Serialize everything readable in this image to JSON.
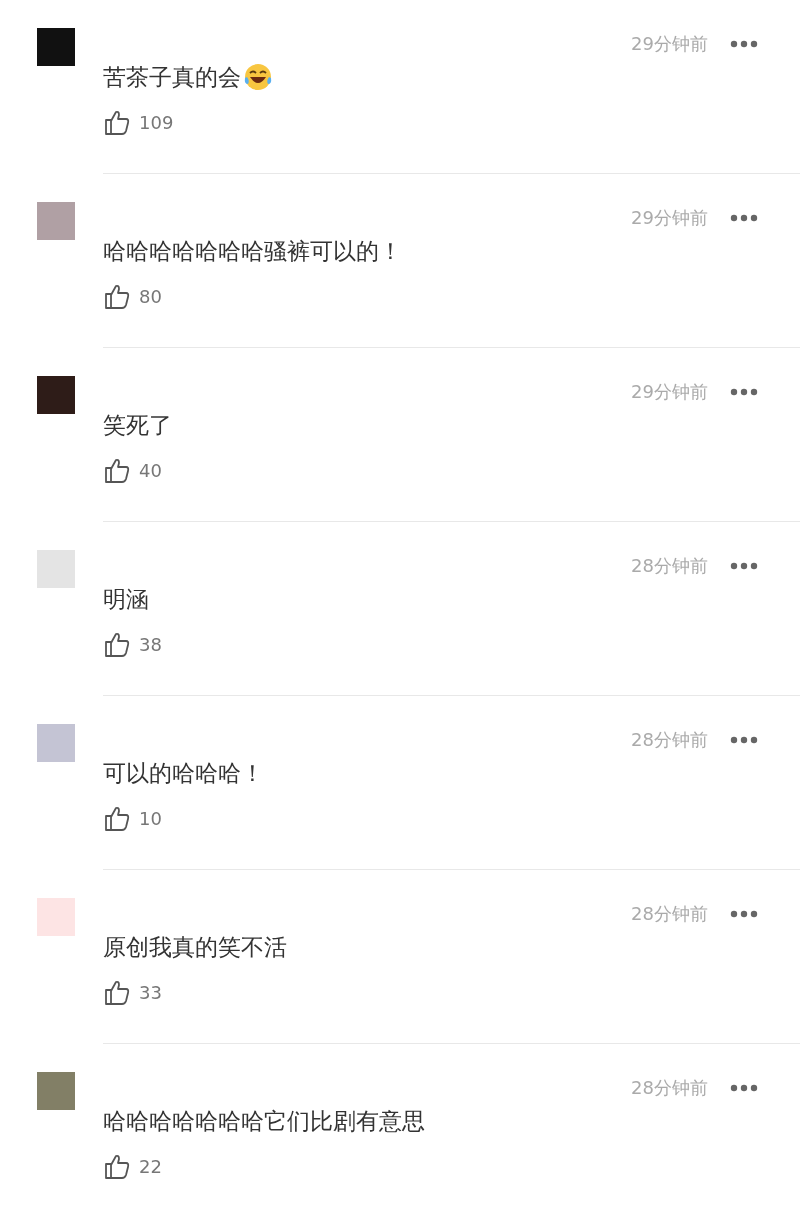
{
  "comments": [
    {
      "avatar": {
        "color": "#111111"
      },
      "time": "29分钟前",
      "text": "苦茶子真的会",
      "emoji": true,
      "likes": "109"
    },
    {
      "avatar": {
        "color": "#b0a0a4"
      },
      "time": "29分钟前",
      "text": "哈哈哈哈哈哈哈骚裤可以的！",
      "emoji": false,
      "likes": "80"
    },
    {
      "avatar": {
        "color": "#2e1c18"
      },
      "time": "29分钟前",
      "text": "笑死了",
      "emoji": false,
      "likes": "40"
    },
    {
      "avatar": {
        "color": "#e4e4e4"
      },
      "time": "28分钟前",
      "text": "明涵",
      "emoji": false,
      "likes": "38"
    },
    {
      "avatar": {
        "color": "#c4c4d4"
      },
      "time": "28分钟前",
      "text": "可以的哈哈哈！",
      "emoji": false,
      "likes": "10"
    },
    {
      "avatar": {
        "color": "#fde4e4"
      },
      "time": "28分钟前",
      "text": "原创我真的笑不活",
      "emoji": false,
      "likes": "33"
    },
    {
      "avatar": {
        "color": "#827f66"
      },
      "time": "28分钟前",
      "text": "哈哈哈哈哈哈哈它们比剧有意思",
      "emoji": false,
      "likes": "22"
    }
  ]
}
